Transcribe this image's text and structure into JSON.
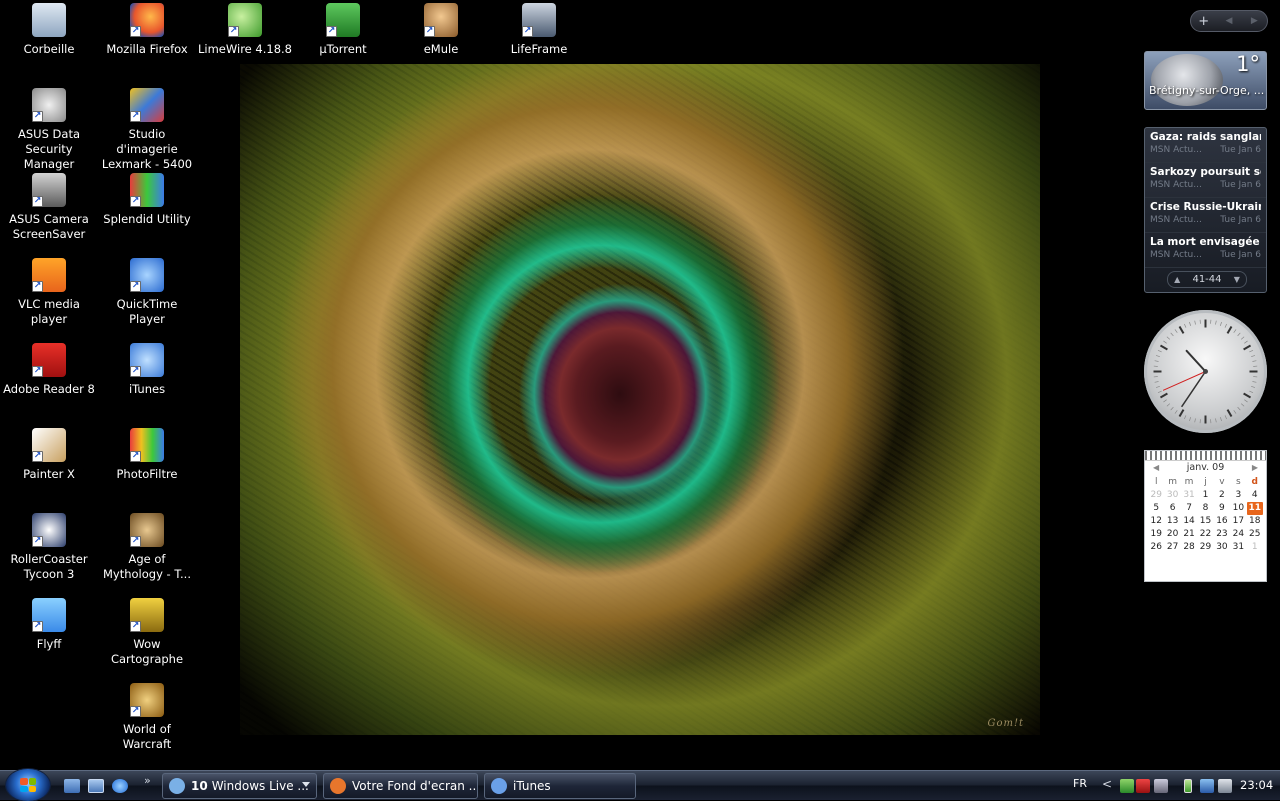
{
  "desktop": {
    "icons": [
      {
        "label": "Corbeille",
        "icon": "recycle-bin-icon",
        "shortcut": false
      },
      {
        "label": "Mozilla Firefox",
        "icon": "firefox-icon",
        "shortcut": true
      },
      {
        "label": "LimeWire 4.18.8",
        "icon": "limewire-icon",
        "shortcut": true
      },
      {
        "label": "µTorrent",
        "icon": "utorrent-icon",
        "shortcut": true
      },
      {
        "label": "eMule",
        "icon": "emule-icon",
        "shortcut": true
      },
      {
        "label": "LifeFrame",
        "icon": "lifeframe-icon",
        "shortcut": true
      },
      {
        "label": "ASUS Data Security Manager",
        "icon": "lock-icon",
        "shortcut": true
      },
      {
        "label": "Studio d'imagerie Lexmark - 5400 ...",
        "icon": "lexmark-icon",
        "shortcut": true
      },
      {
        "label": "ASUS Camera ScreenSaver",
        "icon": "camera-icon",
        "shortcut": true
      },
      {
        "label": "Splendid Utility",
        "icon": "splendid-icon",
        "shortcut": true
      },
      {
        "label": "VLC media player",
        "icon": "vlc-cone-icon",
        "shortcut": true
      },
      {
        "label": "QuickTime Player",
        "icon": "quicktime-icon",
        "shortcut": true
      },
      {
        "label": "Adobe Reader 8",
        "icon": "adobe-reader-icon",
        "shortcut": true
      },
      {
        "label": "iTunes",
        "icon": "itunes-icon",
        "shortcut": true
      },
      {
        "label": "Painter X",
        "icon": "painter-brush-icon",
        "shortcut": true
      },
      {
        "label": "PhotoFiltre",
        "icon": "photofiltre-icon",
        "shortcut": true
      },
      {
        "label": "RollerCoaster Tycoon 3",
        "icon": "rollercoaster-icon",
        "shortcut": true
      },
      {
        "label": "Age of Mythology - T...",
        "icon": "age-of-mythology-icon",
        "shortcut": true
      },
      {
        "label": "Flyff",
        "icon": "flyff-icon",
        "shortcut": true
      },
      {
        "label": "Wow Cartographe",
        "icon": "wow-cartographe-icon",
        "shortcut": true
      },
      {
        "label": "World of Warcraft",
        "icon": "world-of-warcraft-icon",
        "shortcut": true
      }
    ],
    "wallpaper": {
      "signature": "Gom!t"
    }
  },
  "gadgets": {
    "controls": {
      "add": "+",
      "prev": "◀",
      "next": "▶"
    },
    "weather": {
      "temperature": "1°",
      "city": "Brétigny-sur-Orge, ..."
    },
    "news": {
      "items": [
        {
          "title": "Gaza: raids sanglant...",
          "source": "MSN Actu...",
          "date": "Tue Jan 6"
        },
        {
          "title": "Sarkozy poursuit ses ...",
          "source": "MSN Actu...",
          "date": "Tue Jan 6"
        },
        {
          "title": "Crise Russie-Ukraine...",
          "source": "MSN Actu...",
          "date": "Tue Jan 6"
        },
        {
          "title": "La mort envisagée d...",
          "source": "MSN Actu...",
          "date": "Tue Jan 6"
        }
      ],
      "range": "41-44",
      "up": "▲",
      "down": "▼"
    },
    "clock": {
      "hour": 10,
      "minute": 35,
      "second": 41
    },
    "calendar": {
      "month": "janv. 09",
      "prev": "◀",
      "next": "▶",
      "weekdays": [
        "l",
        "m",
        "m",
        "j",
        "v",
        "s",
        "d"
      ],
      "today": "11",
      "weeks": [
        [
          "29",
          "30",
          "31",
          "1",
          "2",
          "3",
          "4"
        ],
        [
          "5",
          "6",
          "7",
          "8",
          "9",
          "10",
          "11"
        ],
        [
          "12",
          "13",
          "14",
          "15",
          "16",
          "17",
          "18"
        ],
        [
          "19",
          "20",
          "21",
          "22",
          "23",
          "24",
          "25"
        ],
        [
          "26",
          "27",
          "28",
          "29",
          "30",
          "31",
          "1"
        ]
      ],
      "other_month": [
        [
          0,
          0
        ],
        [
          0,
          1
        ],
        [
          0,
          2
        ],
        [
          4,
          6
        ]
      ]
    }
  },
  "taskbar": {
    "quick_launch_more": "»",
    "tasks": [
      {
        "count": "10",
        "label": "Windows Live ...",
        "icon": "windows-live-icon",
        "color": "#7ab0e6",
        "has_dropdown": true
      },
      {
        "count": "",
        "label": "Votre Fond d'ecran ...",
        "icon": "firefox-icon",
        "color": "#e8762c",
        "has_dropdown": false
      },
      {
        "count": "",
        "label": "iTunes",
        "icon": "itunes-icon",
        "color": "#6aa0e8",
        "has_dropdown": false
      }
    ],
    "language": "FR",
    "tray_arrow": "<",
    "time": "23:04"
  }
}
